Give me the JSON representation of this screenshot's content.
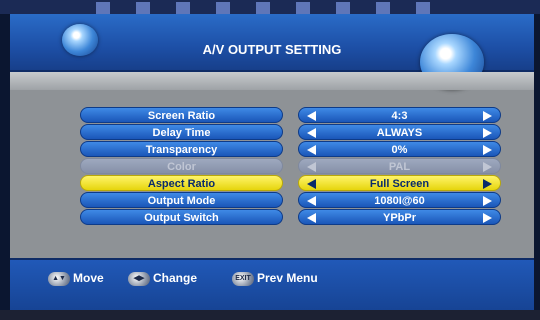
{
  "header": {
    "title": "A/V OUTPUT SETTING"
  },
  "menu": {
    "items": [
      {
        "label": "Screen Ratio",
        "value": "4:3"
      },
      {
        "label": "Delay Time",
        "value": "ALWAYS"
      },
      {
        "label": "Transparency",
        "value": "0%"
      },
      {
        "label": "Color",
        "value": "PAL"
      },
      {
        "label": "Aspect Ratio",
        "value": "Full Screen"
      },
      {
        "label": "Output Mode",
        "value": "1080I@60"
      },
      {
        "label": "Output Switch",
        "value": "YPbPr"
      }
    ],
    "selected_label": "Aspect Ratio",
    "disabled_label": "Color"
  },
  "footer": {
    "move": "Move",
    "change": "Change",
    "exit_icon": "EXIT",
    "prev_menu": "Prev Menu"
  },
  "colors": {
    "header_bg": "#1d4fa6",
    "panel_bg": "#8e9296",
    "item_bg": "#2a6fd0",
    "selected_bg": "#f4e424",
    "disabled_bg": "#9aa4bb"
  },
  "icons": {
    "header_left": "bubble-orb",
    "header_right": "bubble-orb",
    "move": "up-down-arrows",
    "change": "left-right-arrows",
    "exit": "exit-button"
  }
}
